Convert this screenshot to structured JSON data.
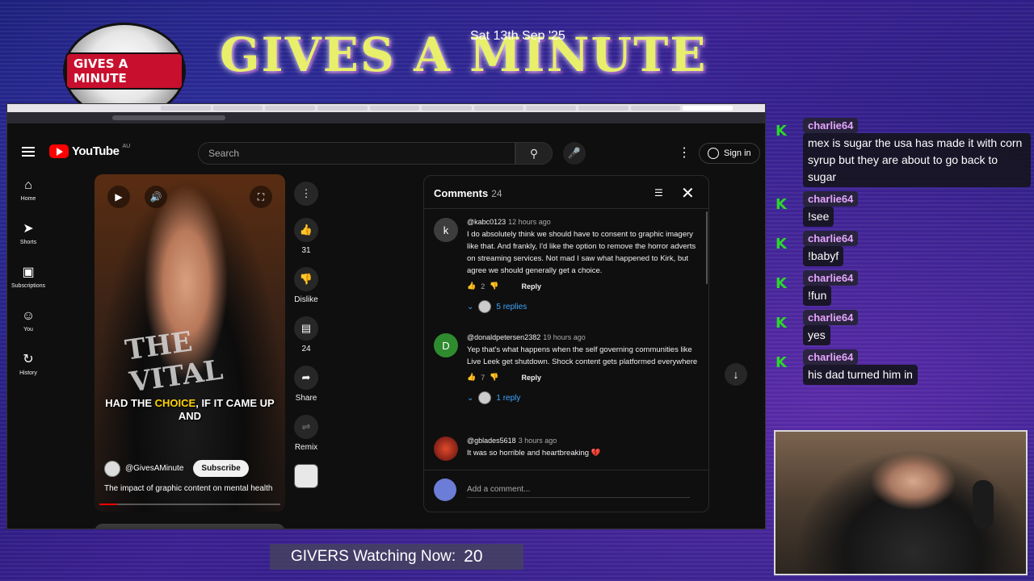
{
  "overlay": {
    "logo_text": "GIVES A MINUTE",
    "title": "GIVES A MINUTE",
    "date": "Sat 13th Sep '25",
    "watching_label": "GIVERS Watching Now:",
    "watching_count": "20"
  },
  "youtube": {
    "logo": "YouTube",
    "region": "AU",
    "search_placeholder": "Search",
    "sign_in": "Sign in",
    "nav": [
      {
        "label": "Home",
        "icon": "home-icon"
      },
      {
        "label": "Shorts",
        "icon": "shorts-icon"
      },
      {
        "label": "Subscriptions",
        "icon": "subscriptions-icon"
      },
      {
        "label": "You",
        "icon": "you-icon"
      },
      {
        "label": "History",
        "icon": "history-icon"
      }
    ],
    "short": {
      "caption_pre": "HAD THE ",
      "caption_highlight": "CHOICE",
      "caption_post": ", IF IT CAME UP AND",
      "shirt_text": "THE VITAL",
      "channel": "@GivesAMinute",
      "subscribe": "Subscribe",
      "title": "The impact of graphic content on mental health",
      "progress": 0.1
    },
    "actions": {
      "likes": "31",
      "dislike": "Dislike",
      "comments": "24",
      "share": "Share",
      "remix": "Remix"
    },
    "comments_panel": {
      "title": "Comments",
      "count": "24",
      "add_placeholder": "Add a comment...",
      "items": [
        {
          "avatar_letter": "k",
          "avatar_color": "#3d3d3d",
          "author": "@kabc0123",
          "time": "12 hours ago",
          "text": "I do absolutely think we should have to consent to graphic imagery like that. And frankly, I'd like the option to remove the horror adverts on streaming services. Not mad I saw what happened to Kirk, but agree we should generally get a choice.",
          "likes": "2",
          "reply": "Reply",
          "replies": "5 replies"
        },
        {
          "avatar_letter": "D",
          "avatar_color": "#2e8b2e",
          "author": "@donaldpetersen2382",
          "time": "19 hours ago",
          "text": "Yep that's what happens when the self governing communities like Live Leek get shutdown. Shock content gets platformed everywhere",
          "likes": "7",
          "reply": "Reply",
          "replies": "1 reply"
        },
        {
          "avatar_letter": "",
          "avatar_color": "#8a1f1f",
          "author": "@gblades5618",
          "time": "3 hours ago",
          "text": "It was so horrible and heartbreaking 💔"
        }
      ]
    }
  },
  "chat": [
    {
      "name": "charlie64",
      "text": "mex is sugar the usa has made it with corn syrup but they are about to go back to sugar"
    },
    {
      "name": "charlie64",
      "text": "!see"
    },
    {
      "name": "charlie64",
      "text": "!babyf"
    },
    {
      "name": "charlie64",
      "text": "!fun"
    },
    {
      "name": "charlie64",
      "text": "yes"
    },
    {
      "name": "charlie64",
      "text": "his dad turned him in"
    }
  ],
  "colors": {
    "youtube_red": "#ff0000",
    "link_blue": "#3ea6ff",
    "chat_name": "#e6a4ff",
    "chat_badge": "#2ad82a",
    "caption_highlight": "#ffd400"
  }
}
